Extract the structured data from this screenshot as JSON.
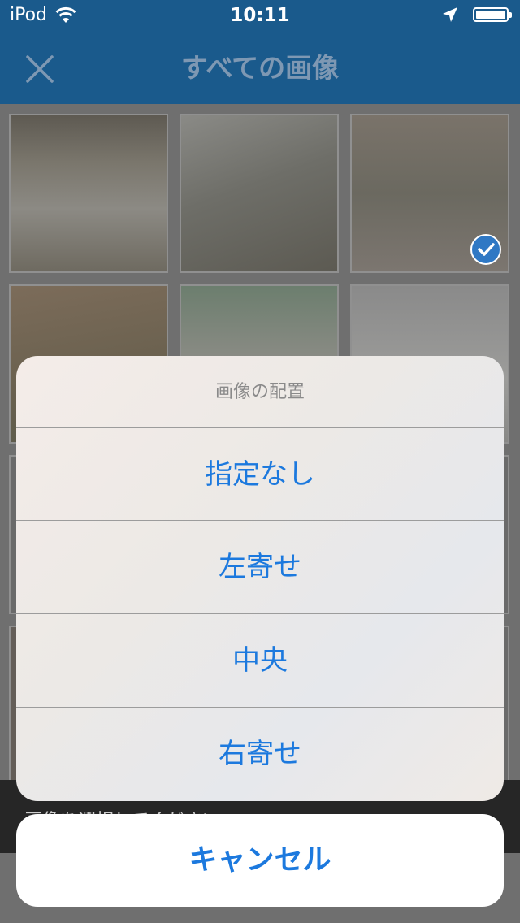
{
  "status_bar": {
    "carrier": "iPod",
    "time": "10:11"
  },
  "nav": {
    "title": "すべての画像"
  },
  "content": {
    "prompt": "画像を選択してください"
  },
  "action_sheet": {
    "title": "画像の配置",
    "options": [
      "指定なし",
      "左寄せ",
      "中央",
      "右寄せ"
    ],
    "cancel_label": "キャンセル"
  },
  "colors": {
    "nav_bg": "#1a5a8c",
    "accent": "#1c79de"
  }
}
